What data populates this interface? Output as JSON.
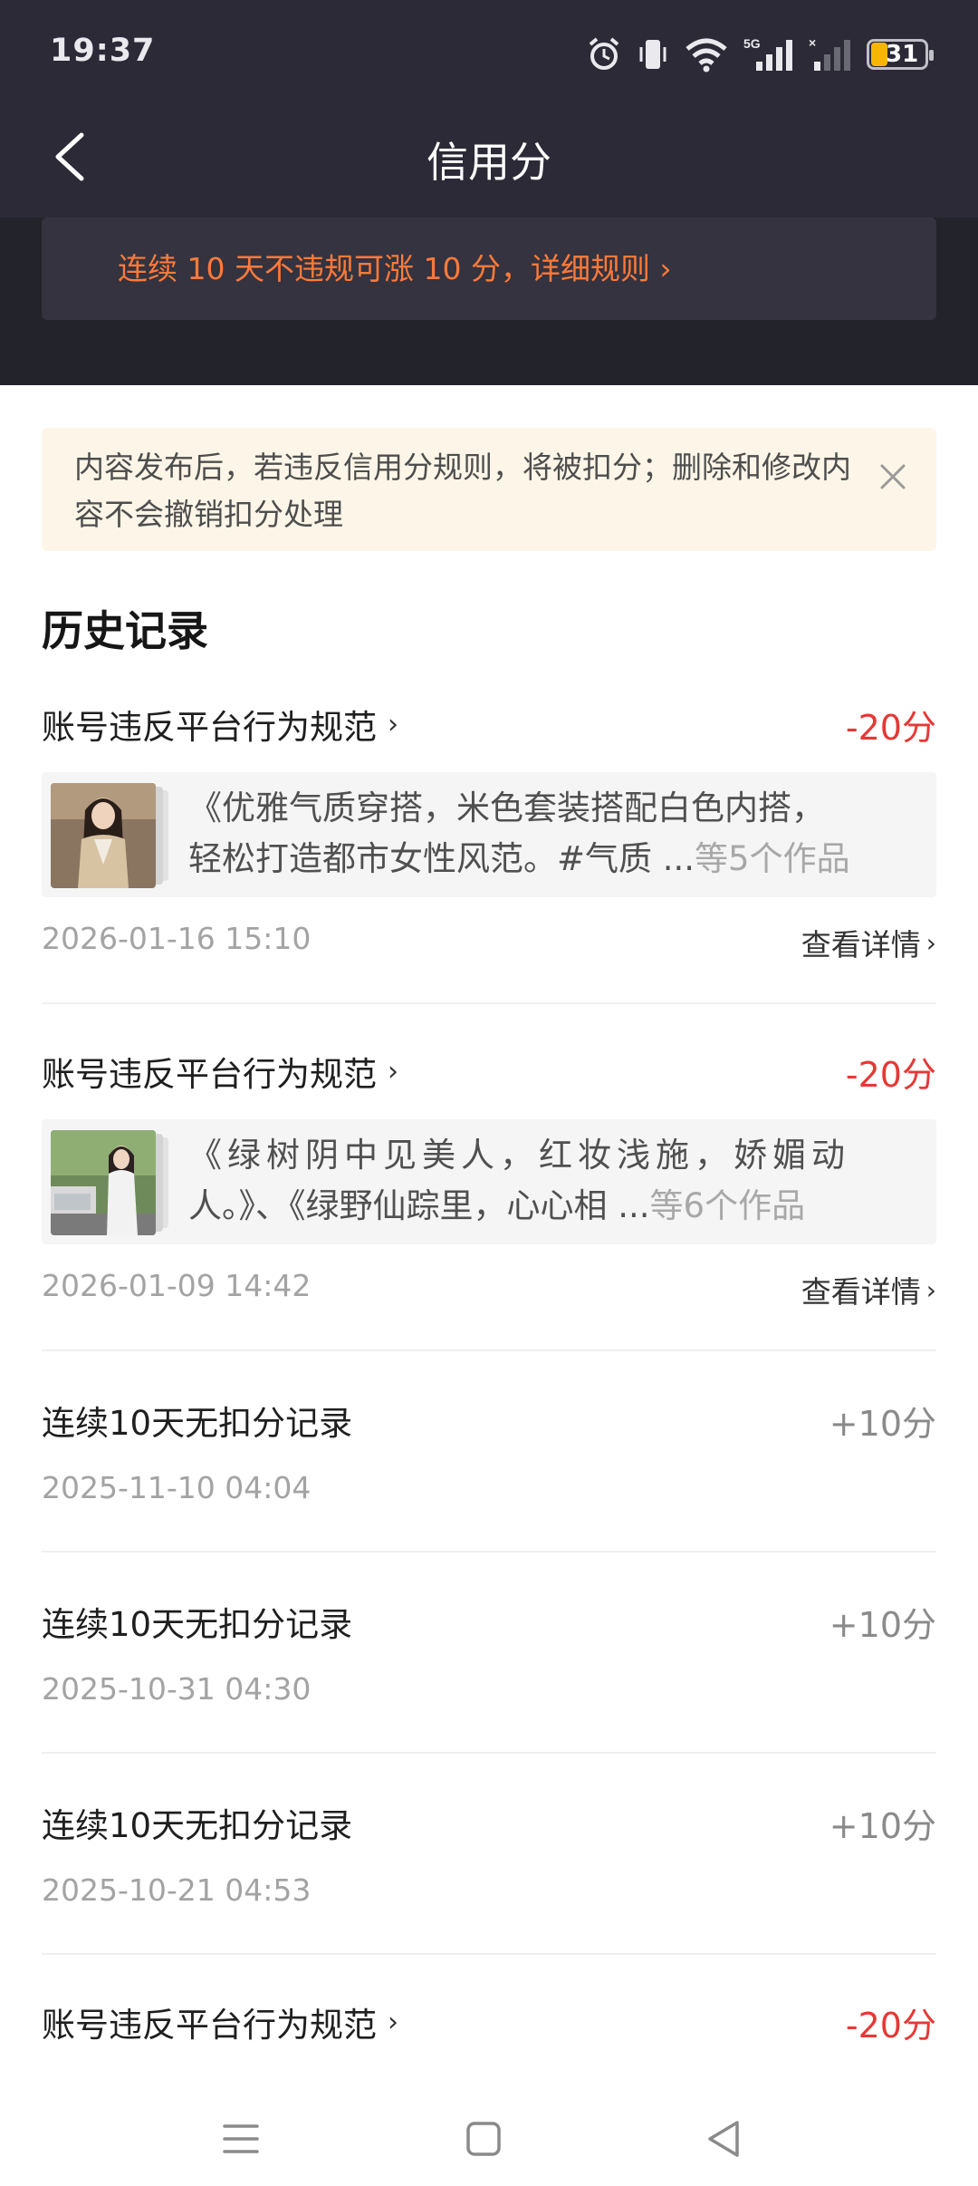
{
  "status_bar": {
    "time": "19:37",
    "network_label": "5G",
    "battery": "31",
    "icons": [
      "alarm-icon",
      "vibrate-icon",
      "wifi-icon",
      "signal-5g-icon",
      "signal-icon",
      "battery-icon"
    ]
  },
  "header": {
    "title": "信用分",
    "back_icon": "back-arrow-icon",
    "rule_hint": "连续 10 天不违规可涨 10 分，详细规则 ›"
  },
  "notice": {
    "text": "内容发布后，若违反信用分规则，将被扣分；删除和修改内容不会撤销扣分处理",
    "close_icon": "close-icon"
  },
  "history": {
    "title": "历史记录",
    "detail_label": "查看详情",
    "records": [
      {
        "title": "账号违反平台行为规范",
        "score": "-20分",
        "works_line1": "《优雅气质穿搭，米色套装搭配白色内搭，",
        "works_line2": "轻松打造都市女性风范。#气质 ...",
        "works_count": "等5个作品",
        "date": "2026-01-16 15:10"
      },
      {
        "title": "账号违反平台行为规范",
        "score": "-20分",
        "works_line1": "《绿树阴中见美人，红妆浅施，娇媚动",
        "works_line2": "人。》、《绿野仙踪里，心心相 ...",
        "works_count": "等6个作品",
        "date": "2026-01-09 14:42"
      },
      {
        "title": "连续10天无扣分记录",
        "score": "+10分",
        "date": "2025-11-10 04:04"
      },
      {
        "title": "连续10天无扣分记录",
        "score": "+10分",
        "date": "2025-10-31 04:30"
      },
      {
        "title": "连续10天无扣分记录",
        "score": "+10分",
        "date": "2025-10-21 04:53"
      },
      {
        "title": "账号违反平台行为规范",
        "score": "-20分"
      }
    ]
  },
  "colors": {
    "header_bg": "#2b2a36",
    "rule_accent": "#ff7a3a",
    "negative": "#e53935",
    "positive": "#8a8a8a",
    "notice_bg": "#fdf6e8"
  },
  "bottom_nav": [
    "menu-icon",
    "home-square-icon",
    "back-triangle-icon"
  ]
}
